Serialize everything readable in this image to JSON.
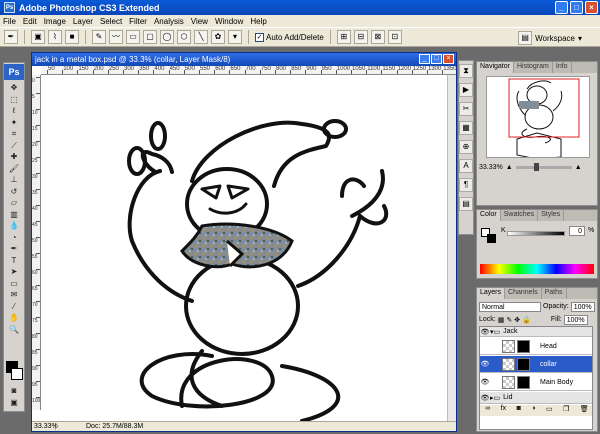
{
  "app": {
    "title": "Adobe Photoshop CS3 Extended"
  },
  "menu": [
    "File",
    "Edit",
    "Image",
    "Layer",
    "Select",
    "Filter",
    "Analysis",
    "View",
    "Window",
    "Help"
  ],
  "options": {
    "auto_add_label": "Auto Add/Delete",
    "workspace_label": "Workspace"
  },
  "document": {
    "title": "jack in a metal box.psd @ 33.3% (collar, Layer Mask/8)",
    "ruler_h": [
      "50",
      "100",
      "150",
      "200",
      "250",
      "300",
      "350",
      "400",
      "450",
      "500",
      "550",
      "600",
      "650",
      "700",
      "750",
      "800",
      "850",
      "900",
      "950",
      "1000",
      "1050",
      "1100",
      "1150",
      "1200",
      "1250",
      "1300",
      "1350"
    ],
    "ruler_v": [
      "0",
      "5",
      "10",
      "15",
      "20",
      "25",
      "30",
      "35",
      "40",
      "45",
      "50",
      "55",
      "60",
      "65",
      "70",
      "75",
      "80",
      "85",
      "90",
      "95",
      "100"
    ],
    "zoom": "33.33%",
    "doc_size": "Doc: 25.7M/88.3M"
  },
  "navigator": {
    "tabs": [
      "Navigator",
      "Histogram",
      "Info"
    ],
    "zoom": "33.33%"
  },
  "color_panel": {
    "tabs": [
      "Color",
      "Swatches",
      "Styles"
    ],
    "channel": "K",
    "value": "0",
    "unit": "%"
  },
  "layers": {
    "tabs": [
      "Layers",
      "Channels",
      "Paths"
    ],
    "blend_mode": "Normal",
    "opacity_label": "Opacity:",
    "opacity": "100%",
    "lock_label": "Lock:",
    "fill_label": "Fill:",
    "fill": "100%",
    "rows": [
      {
        "name": "Jack",
        "kind": "group"
      },
      {
        "name": "Head",
        "kind": "layer"
      },
      {
        "name": "collar",
        "kind": "layer",
        "selected": true
      },
      {
        "name": "Main Body",
        "kind": "layer"
      },
      {
        "name": "Lid",
        "kind": "group"
      }
    ]
  },
  "colors": {
    "title_blue": "#0a5bd8",
    "selection_blue": "#2a5bc8",
    "chrome": "#ece9d8"
  }
}
